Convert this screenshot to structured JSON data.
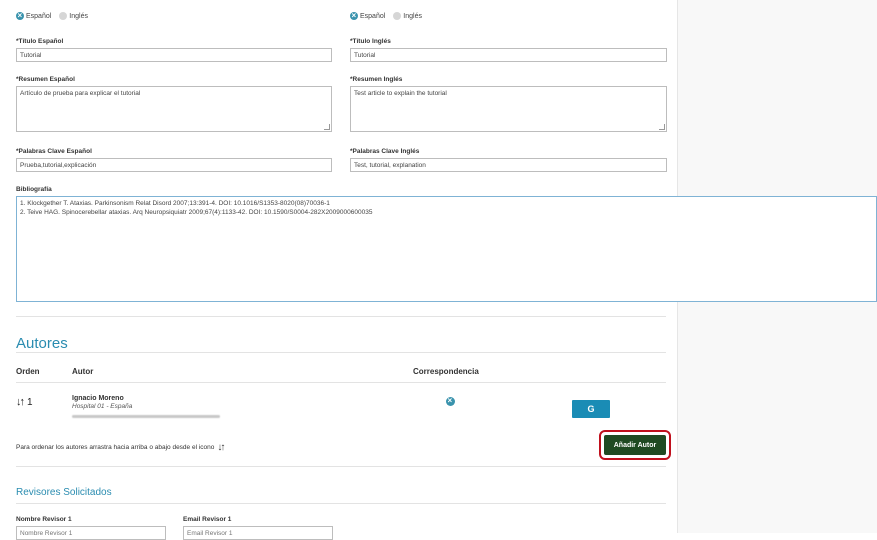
{
  "lang_toggle_left": {
    "option1": "Español",
    "option2": "Inglés"
  },
  "lang_toggle_right": {
    "option1": "Español",
    "option2": "Inglés"
  },
  "titulo_es": {
    "label": "*Título Español",
    "value": "Tutorial"
  },
  "titulo_en": {
    "label": "*Título Inglés",
    "value": "Tutorial"
  },
  "resumen_es": {
    "label": "*Resumen Español",
    "value": "Artículo de prueba para explicar el tutorial"
  },
  "resumen_en": {
    "label": "*Resumen Inglés",
    "value": "Test article to explain the tutorial"
  },
  "palabras_es": {
    "label": "*Palabras Clave Español",
    "value": "Prueba,tutorial,explicación"
  },
  "palabras_en": {
    "label": "*Palabras Clave Inglés",
    "value": "Test, tutorial, explanation"
  },
  "bibliografia": {
    "label": "Bibliografía",
    "line1": "1. Klockgether T. Ataxias. Parkinsonism Relat Disord 2007;13:391-4. DOI: 10.1016/S1353-8020(08)70036-1",
    "line2": "2. Teive HAG. Spinocerebellar ataxias. Arq Neuropsiquiatr 2009;67(4):1133-42. DOI: 10.1590/S0004-282X2009000600035"
  },
  "autores": {
    "title": "Autores",
    "col_orden": "Orden",
    "col_autor": "Autor",
    "col_corresp": "Correspondencia",
    "row1": {
      "orden": "1",
      "name": "Ignacio Moreno",
      "affiliation": "Hospital 01 - España",
      "edit_label": "G"
    },
    "hint": "Para ordenar los autores arrastra hacia arriba o abajo desde el icono",
    "add_label": "Añadir Autor"
  },
  "revisores": {
    "title": "Revisores Solicitados",
    "nombre_label": "Nombre Revisor 1",
    "email_label": "Email Revisor 1",
    "nombre_placeholder": "Nombre Revisor 1",
    "email_placeholder": "Email Revisor 1"
  },
  "icons": {
    "sort": "sort-arrows-icon",
    "check": "check-circle-icon",
    "edit": "edit-icon"
  },
  "colors": {
    "accent": "#2a8cb0",
    "add_button": "#1f4a22",
    "highlight": "#c0101d",
    "edit_button": "#1a8cb5"
  }
}
